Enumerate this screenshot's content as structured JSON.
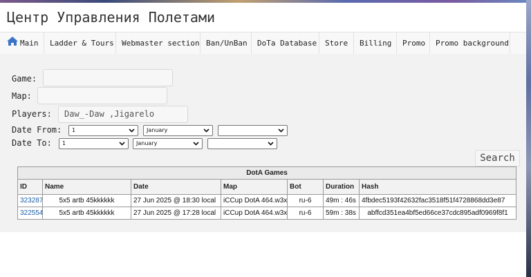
{
  "site_title": "Центр Управления Полетами",
  "nav": [
    {
      "label": "Main",
      "icon": "home-icon"
    },
    {
      "label": "Ladder & Tours"
    },
    {
      "label": "Webmaster section"
    },
    {
      "label": "Ban/UnBan"
    },
    {
      "label": "DoTa Database"
    },
    {
      "label": "Store"
    },
    {
      "label": "Billing"
    },
    {
      "label": "Promo"
    },
    {
      "label": "Promo background"
    }
  ],
  "form": {
    "game_label": "Game:",
    "game_value": "",
    "map_label": "Map:",
    "map_value": "",
    "players_label": "Players:",
    "players_value": "Daw_-Daw ,Jigarelo",
    "date_from_label": "Date From:",
    "date_from": {
      "day": "1",
      "month": "January",
      "year": ""
    },
    "date_to_label": "Date To:",
    "date_to": {
      "day": "1",
      "month": "January",
      "year": ""
    },
    "search_label": "Search"
  },
  "table": {
    "caption": "DotA Games",
    "columns": [
      "ID",
      "Name",
      "Date",
      "Map",
      "Bot",
      "Duration",
      "Hash"
    ],
    "rows": [
      {
        "id": "323287",
        "name": "5x5 artb 45kkkkkk",
        "date": "27 Jun 2025 @ 18:30 local",
        "map": "iCCup DotA 464.w3x",
        "bot": "ru-6",
        "duration": "49m : 46s",
        "hash": "4fbdec5193f42632fac3518f51f4728868dd3e87"
      },
      {
        "id": "322554",
        "name": "5x5 artb 45kkkkkk",
        "date": "27 Jun 2025 @ 17:28 local",
        "map": "iCCup DotA 464.w3x",
        "bot": "ru-6",
        "duration": "59m : 38s",
        "hash": "abffcd351ea4bf5ed66ce37cdc895adf0969f8f1"
      }
    ]
  }
}
